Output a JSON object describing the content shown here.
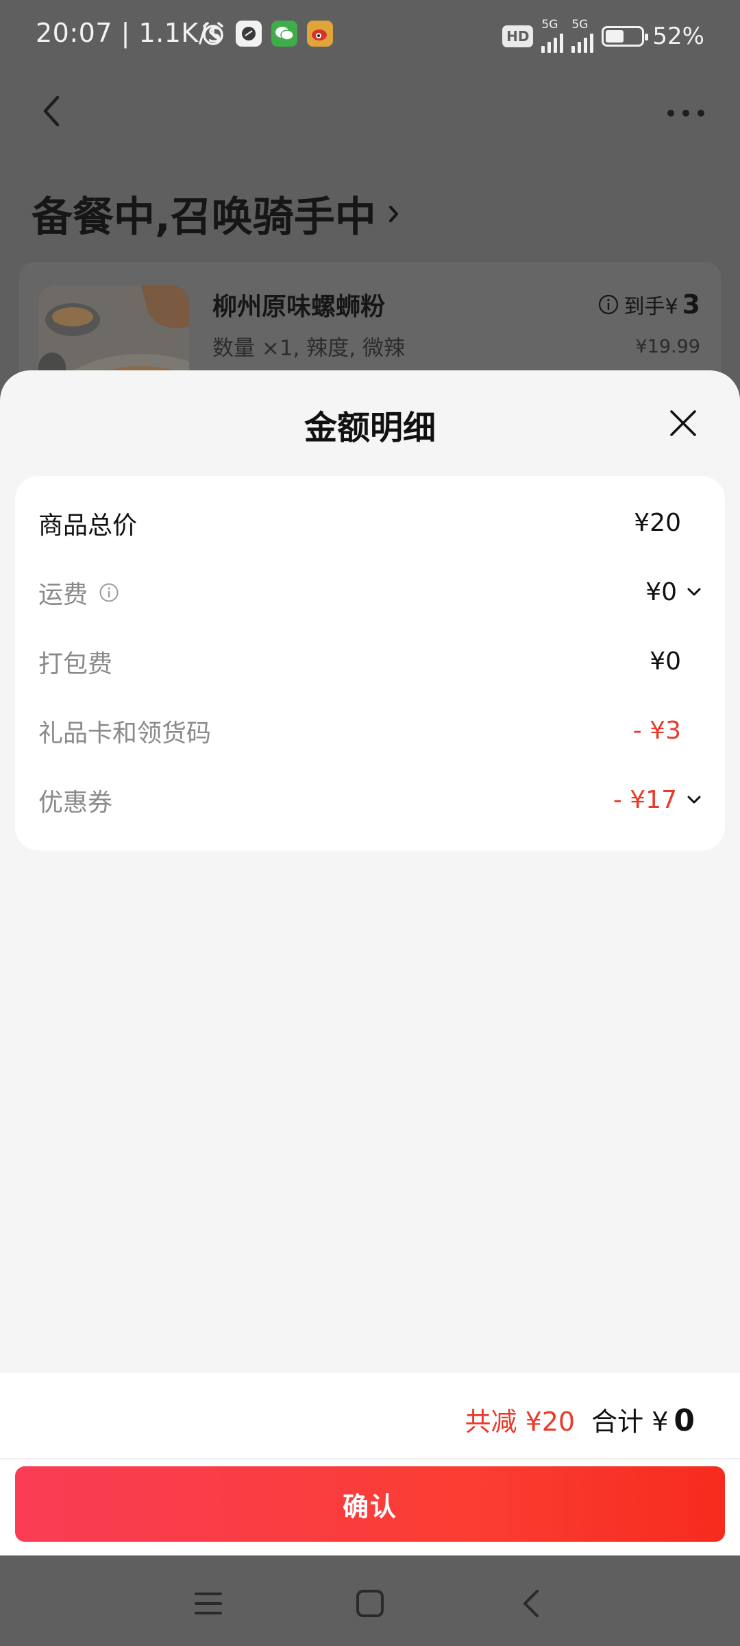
{
  "status_bar": {
    "time": "20:07",
    "speed": "| 1.1K/s",
    "hd_badge": "HD",
    "net_1": "5G",
    "net_2": "5G",
    "battery_pct": "52%",
    "battery_level": 0.52
  },
  "background_page": {
    "title": "备餐中,召唤骑手中",
    "item": {
      "name": "柳州原味螺蛳粉",
      "spec": "数量 ×1, 辣度, 微辣",
      "price_prefix": "到手¥",
      "price_value": "3",
      "original_price": "¥19.99"
    }
  },
  "sheet": {
    "title": "金额明细",
    "rows": [
      {
        "label": "商品总价",
        "amount": "¥20"
      },
      {
        "label": "运费",
        "amount": "¥0"
      },
      {
        "label": "打包费",
        "amount": "¥0"
      },
      {
        "label": "礼品卡和领货码",
        "amount": "- ¥3"
      },
      {
        "label": "优惠券",
        "amount": "- ¥17"
      }
    ],
    "summary": {
      "saved": "共减 ¥20",
      "total_label": "合计 ¥",
      "total_value": "0"
    },
    "confirm_label": "确认"
  },
  "colors": {
    "accent_red": "#e93a2a",
    "button_gradient_start": "#f93d55",
    "button_gradient_end": "#f62b1e",
    "overlay": "#5f5f5f"
  },
  "icons": [
    "alarm-icon",
    "app-icon",
    "wechat-icon",
    "weibo-icon",
    "back-arrow-icon",
    "more-dots-icon",
    "chevron-right-icon",
    "info-icon",
    "close-icon",
    "chevron-down-icon",
    "menu-icon",
    "home-icon",
    "back-nav-icon"
  ]
}
